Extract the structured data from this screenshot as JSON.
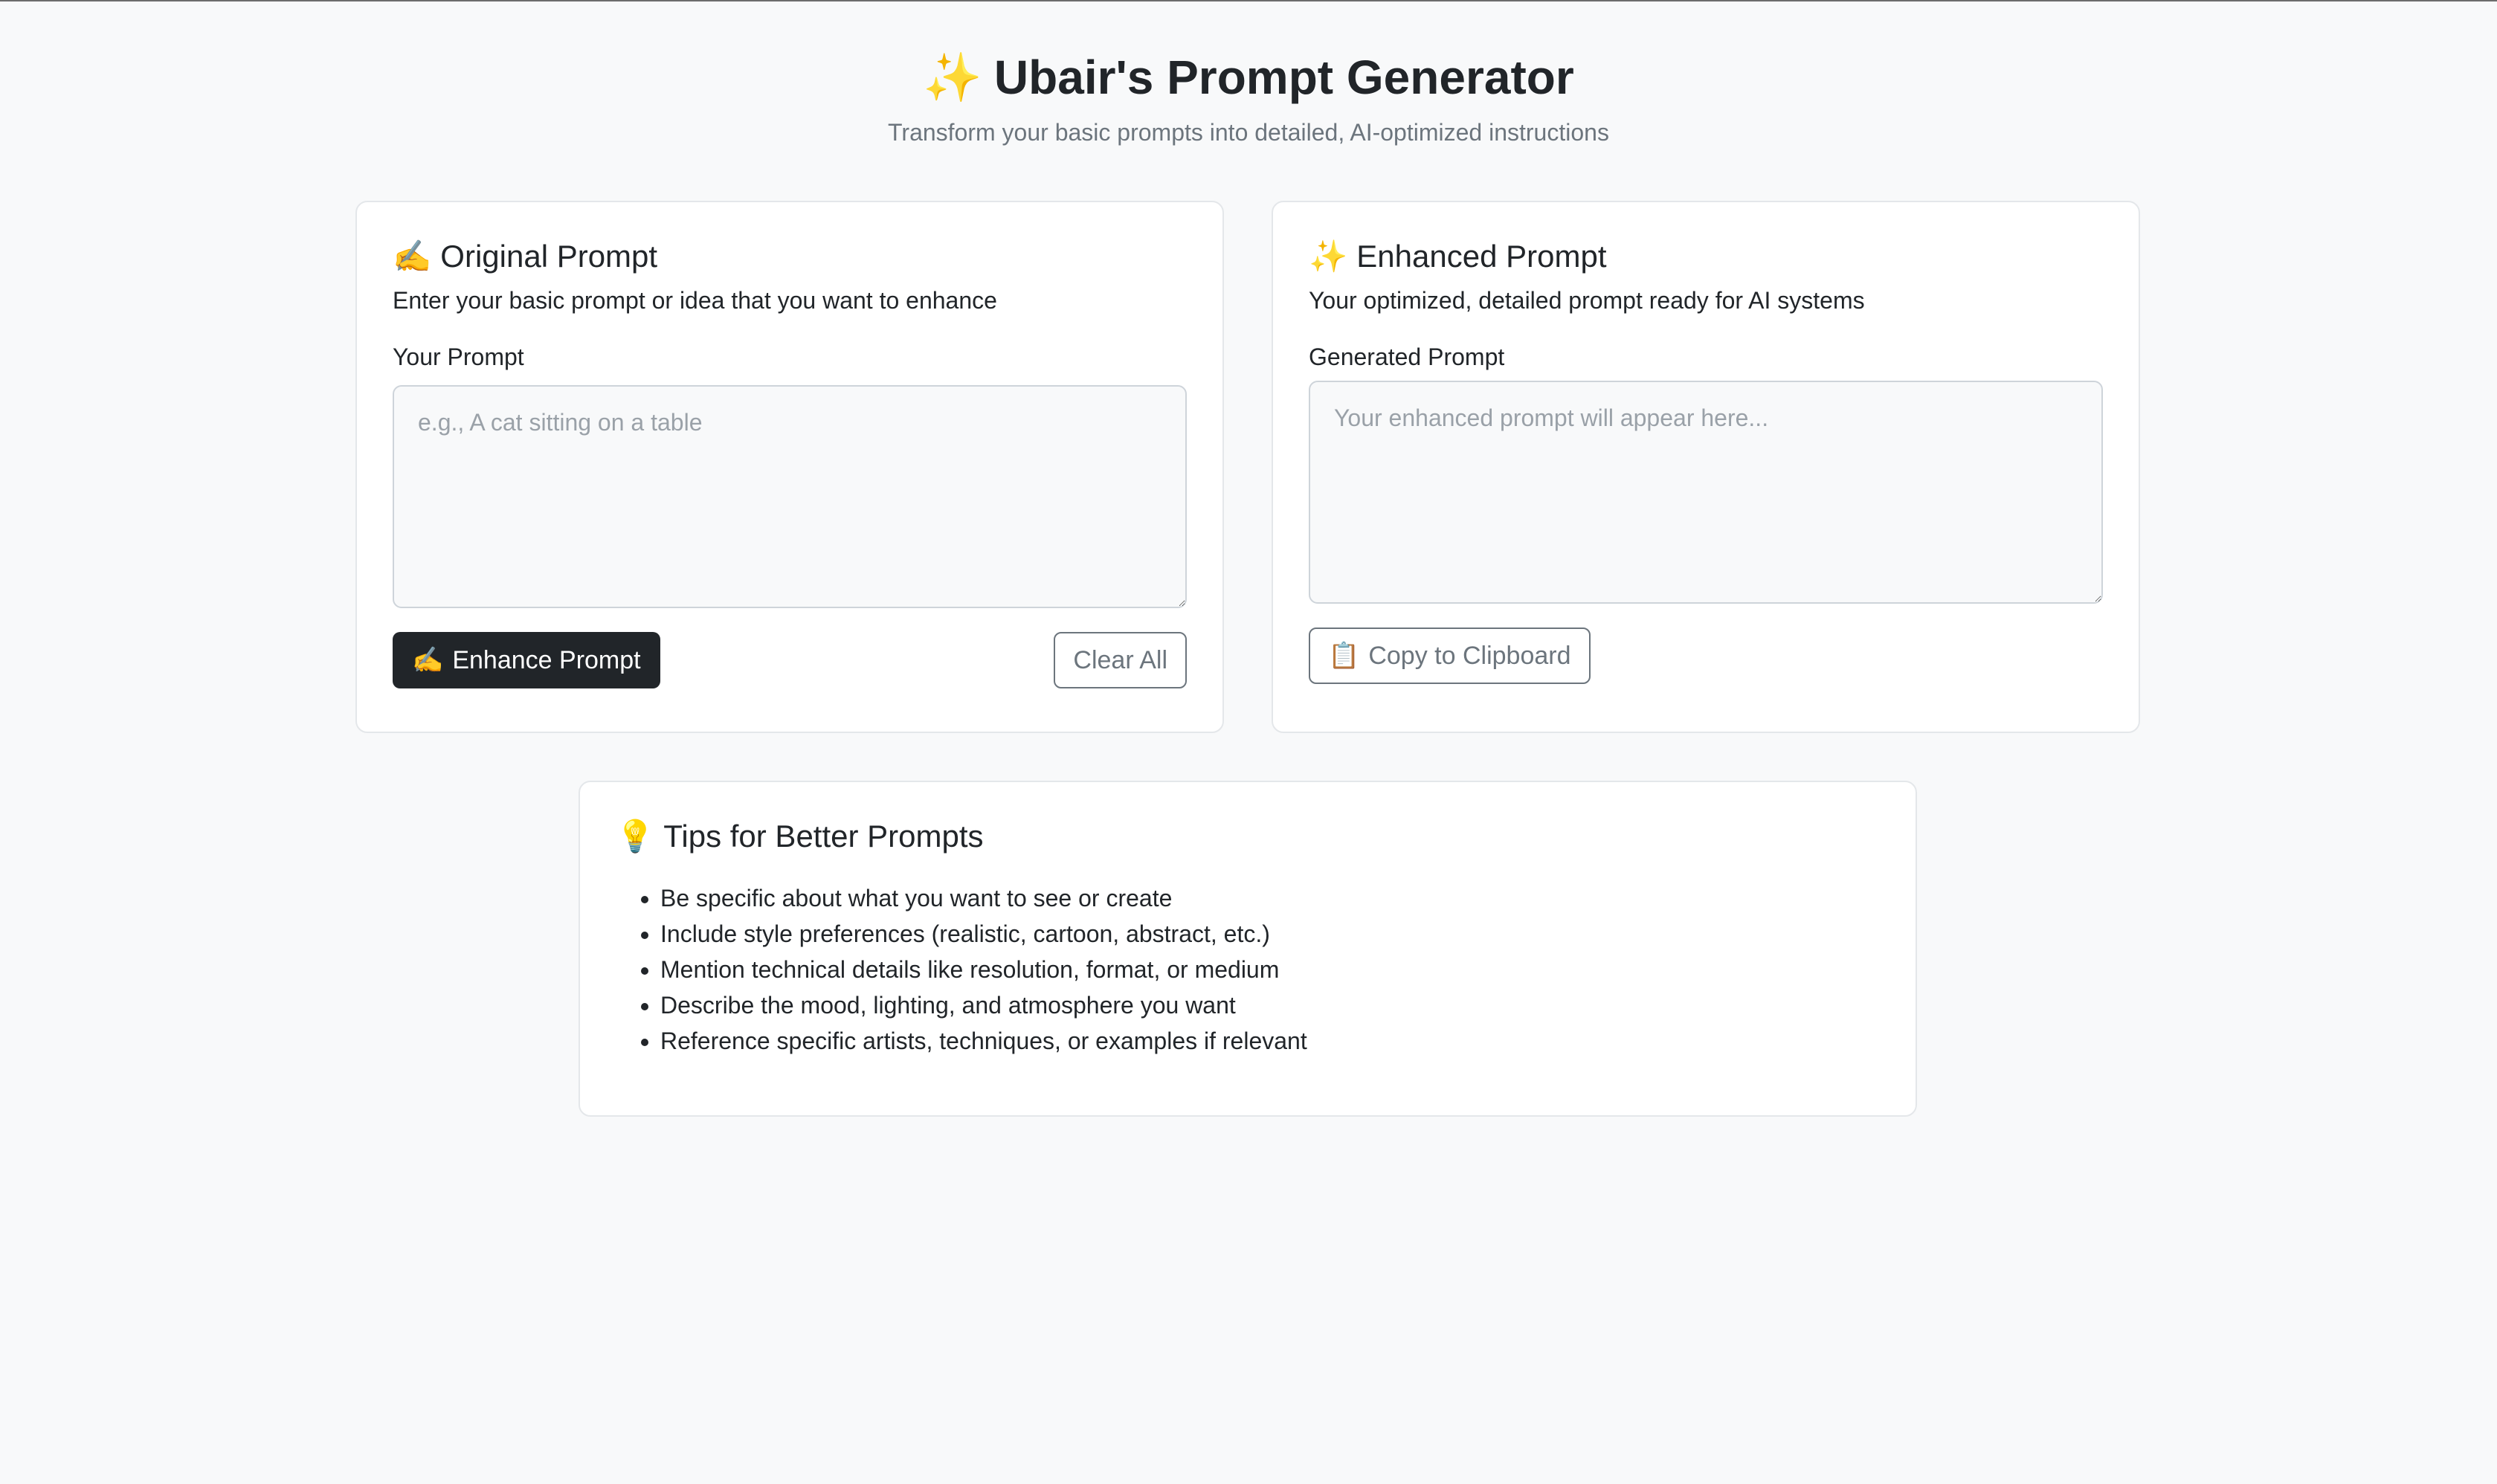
{
  "header": {
    "icon": "sparkles-icon",
    "icon_glyph": "✨",
    "title": "Ubair's Prompt Generator",
    "subtitle": "Transform your basic prompts into detailed, AI-optimized instructions"
  },
  "original": {
    "icon_glyph": "✍️",
    "title": "Original Prompt",
    "description": "Enter your basic prompt or idea that you want to enhance",
    "field_label": "Your Prompt",
    "placeholder": "e.g., A cat sitting on a table",
    "value": "",
    "enhance_icon_glyph": "✍️",
    "enhance_label": "Enhance Prompt",
    "clear_label": "Clear All"
  },
  "enhanced": {
    "icon_glyph": "✨",
    "title": "Enhanced Prompt",
    "description": "Your optimized, detailed prompt ready for AI systems",
    "field_label": "Generated Prompt",
    "placeholder": "Your enhanced prompt will appear here...",
    "value": "",
    "copy_icon_glyph": "📋",
    "copy_label": "Copy to Clipboard"
  },
  "tips": {
    "icon_glyph": "💡",
    "title": "Tips for Better Prompts",
    "items": [
      "Be specific about what you want to see or create",
      "Include style preferences (realistic, cartoon, abstract, etc.)",
      "Mention technical details like resolution, format, or medium",
      "Describe the mood, lighting, and atmosphere you want",
      "Reference specific artists, techniques, or examples if relevant"
    ]
  },
  "colors": {
    "background": "#f8f9fa",
    "primary_button": "#212529",
    "secondary_text": "#6c757d"
  }
}
